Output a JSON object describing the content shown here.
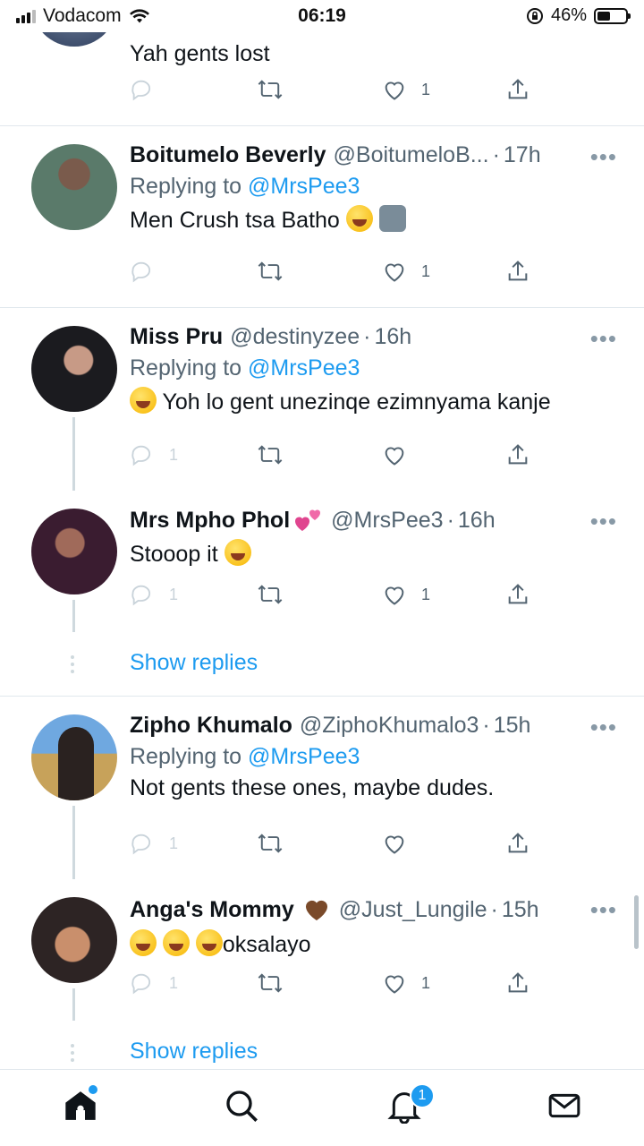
{
  "status_bar": {
    "carrier": "Vodacom",
    "time": "06:19",
    "battery_percent": "46%",
    "battery_level": 0.46
  },
  "tweets": [
    {
      "text": "Yah gents lost",
      "like_count": "1"
    },
    {
      "name": "Boitumelo Beverly",
      "handle": "@BoitumeloB...",
      "time": "17h",
      "replying_label": "Replying to",
      "replying_to": "@MrsPee3",
      "text": "Men Crush tsa Batho",
      "like_count": "1"
    },
    {
      "name": "Miss Pru",
      "handle": "@destinyzee",
      "time": "16h",
      "replying_label": "Replying to",
      "replying_to": "@MrsPee3",
      "text": "Yoh lo gent unezinqe ezimnyama kanje",
      "reply_count": "1"
    },
    {
      "name": "Mrs Mpho Phol",
      "handle": "@MrsPee3",
      "time": "16h",
      "text": "Stooop it",
      "reply_count": "1",
      "like_count": "1"
    },
    {
      "name": "Zipho Khumalo",
      "handle": "@ZiphoKhumalo3",
      "time": "15h",
      "replying_label": "Replying to",
      "replying_to": "@MrsPee3",
      "text": "Not gents these ones, maybe dudes.",
      "reply_count": "1"
    },
    {
      "name": "Anga's Mommy",
      "handle": "@Just_Lungile",
      "time": "15h",
      "text": "oksalayo",
      "reply_count": "1",
      "like_count": "1"
    }
  ],
  "show_replies_label": "Show replies",
  "tab_bar": {
    "notifications_badge": "1",
    "tabs": [
      "home-icon",
      "search-icon",
      "bell-icon",
      "mail-icon"
    ]
  },
  "colors": {
    "accent": "#1d9bf0",
    "text": "#0f1419",
    "secondary": "#536471"
  }
}
